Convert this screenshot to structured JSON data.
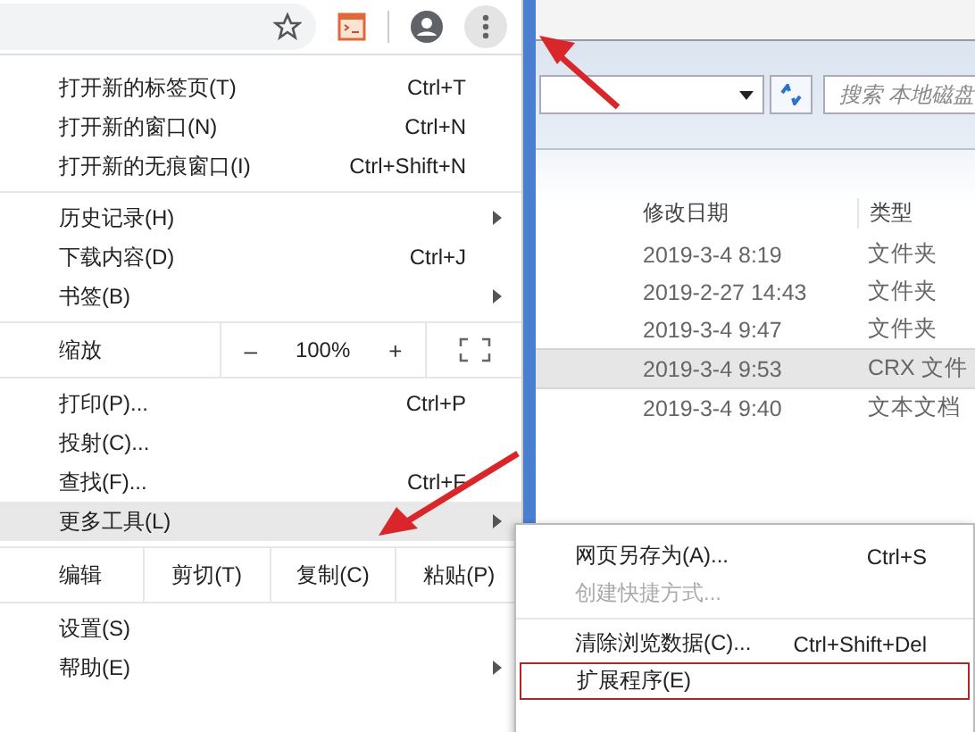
{
  "menu": {
    "sections": [
      {
        "items": [
          {
            "kind": "item",
            "label": "打开新的标签页(T)",
            "shortcut": "Ctrl+T",
            "submenu": false,
            "highlighted": false
          },
          {
            "kind": "item",
            "label": "打开新的窗口(N)",
            "shortcut": "Ctrl+N",
            "submenu": false,
            "highlighted": false
          },
          {
            "kind": "item",
            "label": "打开新的无痕窗口(I)",
            "shortcut": "Ctrl+Shift+N",
            "submenu": false,
            "highlighted": false
          }
        ]
      },
      {
        "items": [
          {
            "kind": "item",
            "label": "历史记录(H)",
            "submenu": true,
            "highlighted": false
          },
          {
            "kind": "item",
            "label": "下载内容(D)",
            "shortcut": "Ctrl+J",
            "submenu": false,
            "highlighted": false
          },
          {
            "kind": "item",
            "label": "书签(B)",
            "submenu": true,
            "highlighted": false
          }
        ]
      },
      {
        "items": [
          {
            "kind": "zoom",
            "label": "缩放",
            "minus": "–",
            "value": "100%",
            "plus": "+"
          }
        ]
      },
      {
        "items": [
          {
            "kind": "item",
            "label": "打印(P)...",
            "shortcut": "Ctrl+P",
            "submenu": false,
            "highlighted": false
          },
          {
            "kind": "item",
            "label": "投射(C)...",
            "submenu": false,
            "highlighted": false
          },
          {
            "kind": "item",
            "label": "查找(F)...",
            "shortcut": "Ctrl+F",
            "submenu": false,
            "highlighted": false
          },
          {
            "kind": "item",
            "label": "更多工具(L)",
            "submenu": true,
            "highlighted": true
          }
        ]
      },
      {
        "items": [
          {
            "kind": "edit",
            "label": "编辑",
            "buttons": [
              "剪切(T)",
              "复制(C)",
              "粘贴(P)"
            ]
          }
        ]
      },
      {
        "items": [
          {
            "kind": "item",
            "label": "设置(S)",
            "submenu": false,
            "highlighted": false
          },
          {
            "kind": "item",
            "label": "帮助(E)",
            "submenu": true,
            "highlighted": false
          }
        ]
      }
    ]
  },
  "submenu": {
    "sections": [
      {
        "items": [
          {
            "label": "网页另存为(A)...",
            "shortcut": "Ctrl+S",
            "disabled": false,
            "outlined": false
          },
          {
            "label": "创建快捷方式...",
            "disabled": true,
            "outlined": false
          }
        ]
      },
      {
        "items": [
          {
            "label": "清除浏览数据(C)...",
            "shortcut": "Ctrl+Shift+Del",
            "disabled": false,
            "outlined": false
          },
          {
            "label": "扩展程序(E)",
            "disabled": false,
            "outlined": true
          }
        ]
      }
    ]
  },
  "explorer": {
    "search": {
      "placeholder": "搜索 本地磁盘"
    },
    "columns": [
      "修改日期",
      "类型"
    ],
    "rows": [
      {
        "date": "2019-3-4 8:19",
        "type": "文件夹",
        "selected": false
      },
      {
        "date": "2019-2-27 14:43",
        "type": "文件夹",
        "selected": false
      },
      {
        "date": "2019-3-4 9:47",
        "type": "文件夹",
        "selected": false
      },
      {
        "date": "2019-3-4 9:53",
        "type": "CRX 文件",
        "selected": true
      },
      {
        "date": "2019-3-4 9:40",
        "type": "文本文档",
        "selected": false
      }
    ]
  }
}
